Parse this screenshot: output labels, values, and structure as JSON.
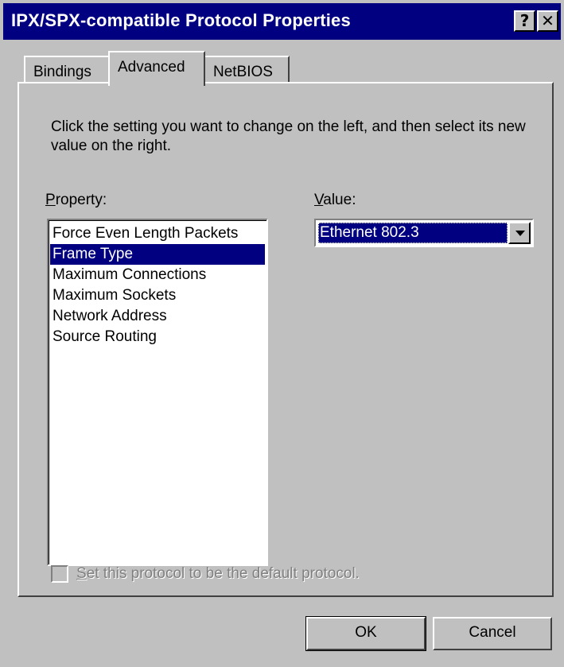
{
  "window": {
    "title": "IPX/SPX-compatible Protocol Properties",
    "help_glyph": "?",
    "close_glyph": "✕"
  },
  "tabs": [
    {
      "label": "Bindings"
    },
    {
      "label": "Advanced"
    },
    {
      "label": "NetBIOS"
    }
  ],
  "advanced": {
    "instructions": "Click the setting you want to change on the left, and then select its new value on the right.",
    "property_label_access": "P",
    "property_label_rest": "roperty:",
    "value_label_access": "V",
    "value_label_rest": "alue:",
    "properties": [
      "Force Even Length Packets",
      "Frame Type",
      "Maximum Connections",
      "Maximum Sockets",
      "Network Address",
      "Source Routing"
    ],
    "selected_property": "Frame Type",
    "value": "Ethernet 802.3",
    "default_checkbox_access": "S",
    "default_checkbox_rest": "et this protocol to be the default protocol."
  },
  "buttons": {
    "ok": "OK",
    "cancel": "Cancel"
  }
}
